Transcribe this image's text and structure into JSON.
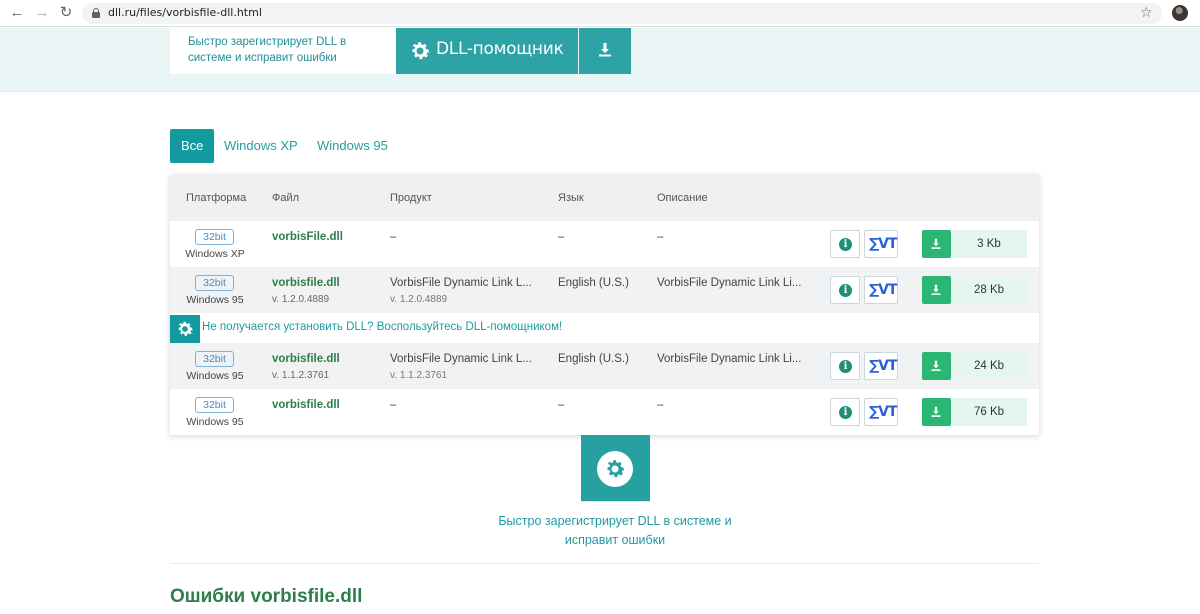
{
  "browser": {
    "url": "dll.ru/files/vorbisfile-dll.html"
  },
  "promo": {
    "text": "Быстро зарегистрирует DLL в системе и исправит ошибки",
    "helper_label": "DLL-помощник"
  },
  "tabs": [
    {
      "label": "Все",
      "active": true
    },
    {
      "label": "Windows XP",
      "active": false
    },
    {
      "label": "Windows 95",
      "active": false
    }
  ],
  "table": {
    "headers": {
      "platform": "Платформа",
      "file": "Файл",
      "product": "Продукт",
      "language": "Язык",
      "description": "Описание"
    },
    "rows": [
      {
        "bit": "32bit",
        "platform": "Windows XP",
        "file": "vorbisFile.dll",
        "version": "",
        "product": "–",
        "product_version": "",
        "language": "–",
        "description": "–",
        "size": "3 Kb"
      },
      {
        "bit": "32bit",
        "platform": "Windows 95",
        "file": "vorbisfile.dll",
        "version": "v. 1.2.0.4889",
        "product": "VorbisFile Dynamic Link L...",
        "product_version": "v. 1.2.0.4889",
        "language": "English (U.S.)",
        "description": "VorbisFile Dynamic Link Li...",
        "size": "28 Kb"
      },
      {
        "bit": "32bit",
        "platform": "Windows 95",
        "file": "vorbisfile.dll",
        "version": "v. 1.1.2.3761",
        "product": "VorbisFile Dynamic Link L...",
        "product_version": "v. 1.1.2.3761",
        "language": "English (U.S.)",
        "description": "VorbisFile Dynamic Link Li...",
        "size": "24 Kb"
      },
      {
        "bit": "32bit",
        "platform": "Windows 95",
        "file": "vorbisfile.dll",
        "version": "",
        "product": "–",
        "product_version": "",
        "language": "–",
        "description": "–",
        "size": "76 Kb"
      }
    ],
    "notice": "Не получается установить DLL? Воспользуйтесь DLL-помощником!",
    "vt_label": "VT"
  },
  "helper_block": {
    "text": "Быстро зарегистрирует DLL в системе и исправит ошибки"
  },
  "errors_title": "Ошибки vorbisfile.dll",
  "colors": {
    "teal": "#139a9e",
    "green_button": "#2bb673",
    "file_green": "#2e7d4b",
    "vt_blue": "#2b5fd9"
  }
}
